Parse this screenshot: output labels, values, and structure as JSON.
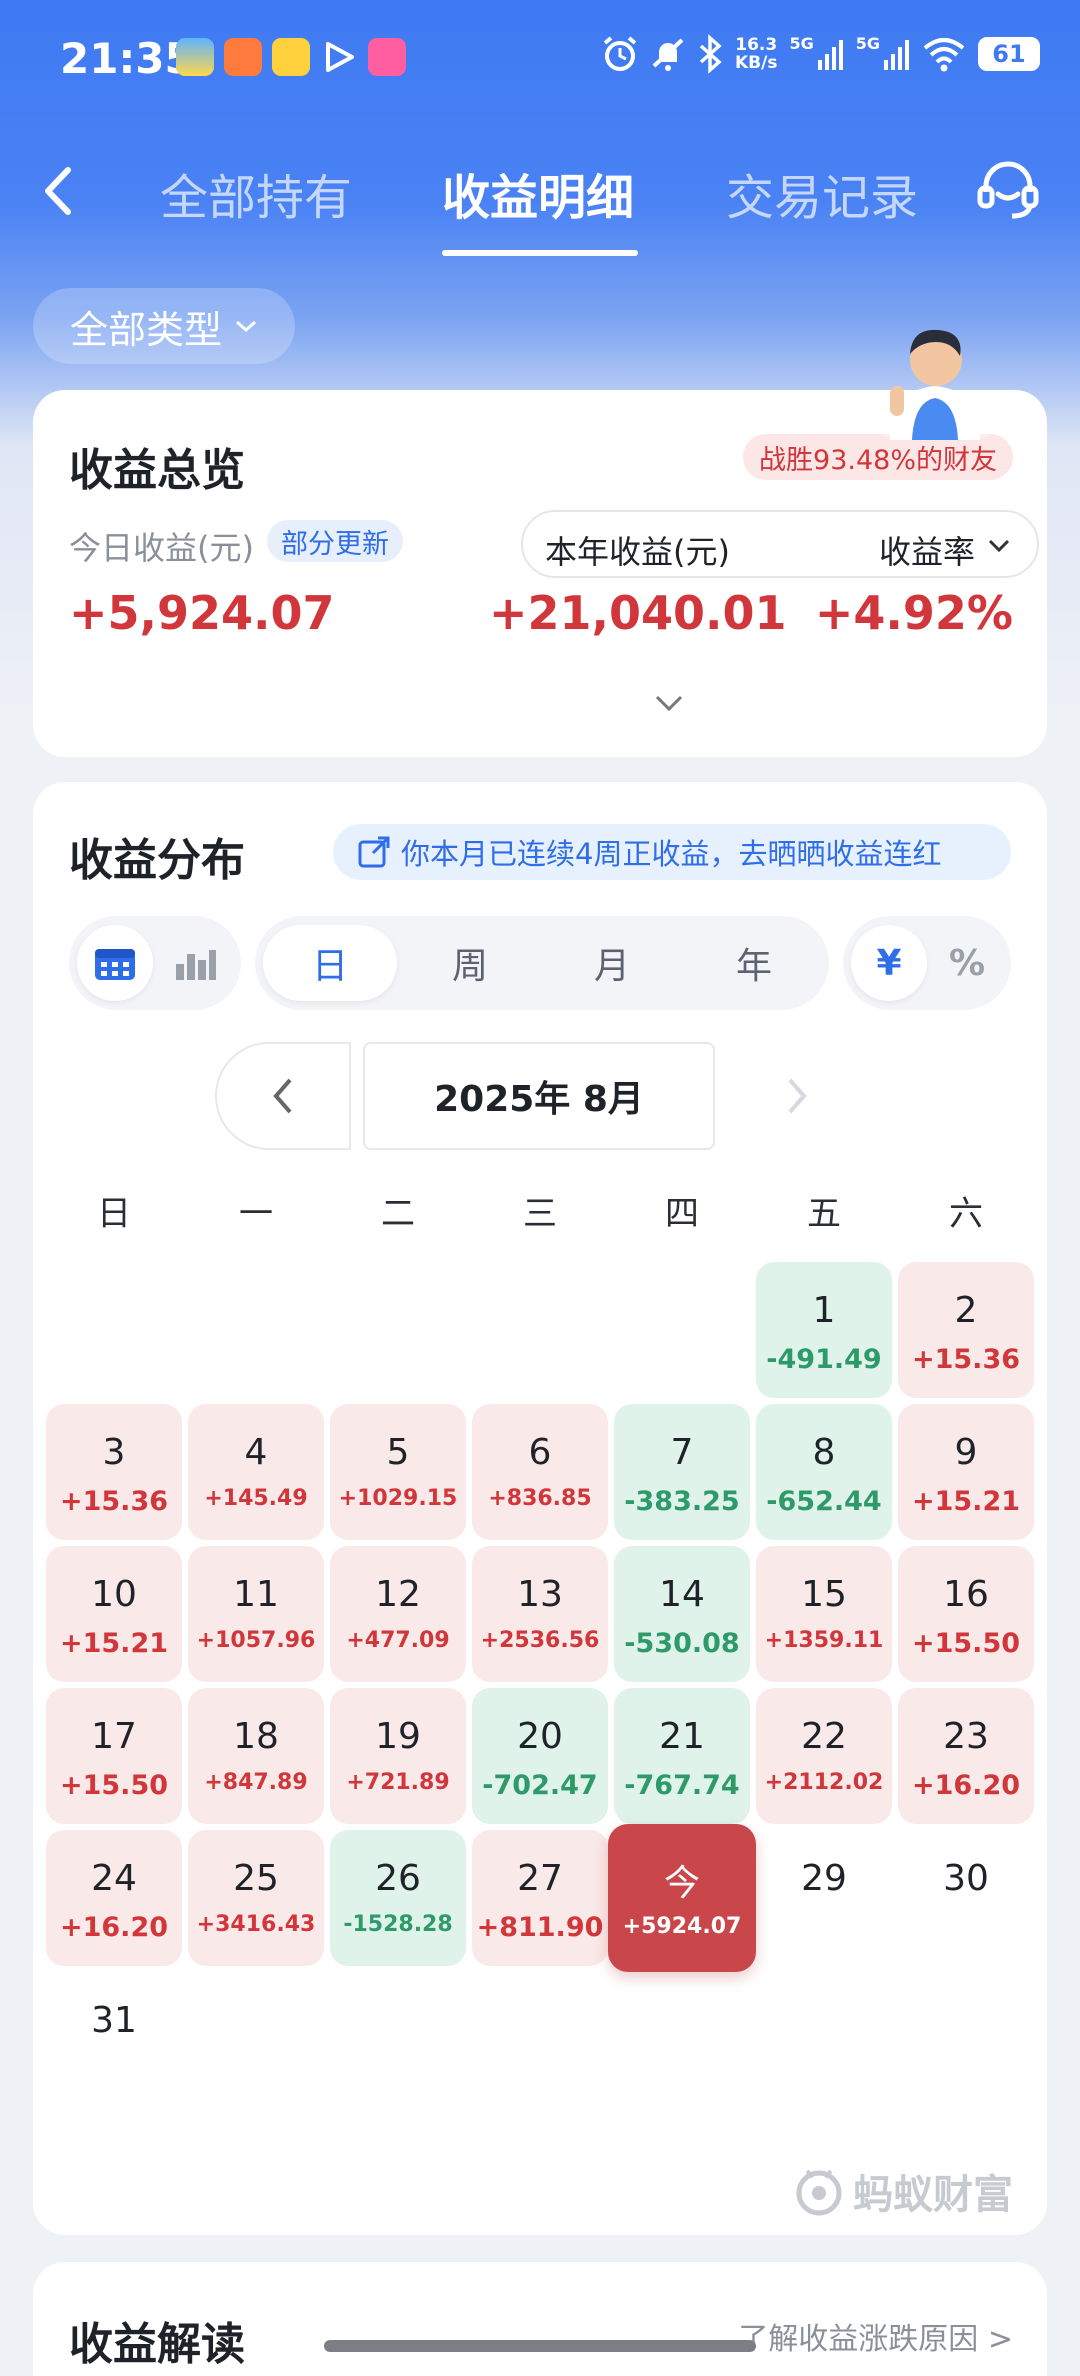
{
  "status": {
    "time": "21:35",
    "net_speed_value": "16.3",
    "net_speed_unit": "KB/s",
    "signal1": "5G",
    "signal2": "5G",
    "battery": "61"
  },
  "nav": {
    "tabs": [
      "全部持有",
      "收益明细",
      "交易记录"
    ],
    "active_tab": "收益明细"
  },
  "filter": {
    "label": "全部类型"
  },
  "overview": {
    "title": "收益总览",
    "beat_badge": "战胜93.48%的财友",
    "today_label": "今日收益(元)",
    "partial_badge": "部分更新",
    "year_label": "本年收益(元)",
    "rate_label": "收益率",
    "today_value": "+5,924.07",
    "year_value": "+21,040.01",
    "rate_value": "+4.92%"
  },
  "distribution": {
    "title": "收益分布",
    "streak_banner": "你本月已连续4周正收益，去晒晒收益连红",
    "periods": [
      "日",
      "周",
      "月",
      "年"
    ],
    "unit_yuan": "¥",
    "unit_pct": "%",
    "month": "2025年 8月",
    "weekdays": [
      "日",
      "一",
      "二",
      "三",
      "四",
      "五",
      "六"
    ],
    "days": [
      {
        "d": "1",
        "v": "-491.49"
      },
      {
        "d": "2",
        "v": "+15.36"
      },
      {
        "d": "3",
        "v": "+15.36"
      },
      {
        "d": "4",
        "v": "+145.49"
      },
      {
        "d": "5",
        "v": "+1029.15"
      },
      {
        "d": "6",
        "v": "+836.85"
      },
      {
        "d": "7",
        "v": "-383.25"
      },
      {
        "d": "8",
        "v": "-652.44"
      },
      {
        "d": "9",
        "v": "+15.21"
      },
      {
        "d": "10",
        "v": "+15.21"
      },
      {
        "d": "11",
        "v": "+1057.96"
      },
      {
        "d": "12",
        "v": "+477.09"
      },
      {
        "d": "13",
        "v": "+2536.56"
      },
      {
        "d": "14",
        "v": "-530.08"
      },
      {
        "d": "15",
        "v": "+1359.11"
      },
      {
        "d": "16",
        "v": "+15.50"
      },
      {
        "d": "17",
        "v": "+15.50"
      },
      {
        "d": "18",
        "v": "+847.89"
      },
      {
        "d": "19",
        "v": "+721.89"
      },
      {
        "d": "20",
        "v": "-702.47"
      },
      {
        "d": "21",
        "v": "-767.74"
      },
      {
        "d": "22",
        "v": "+2112.02"
      },
      {
        "d": "23",
        "v": "+16.20"
      },
      {
        "d": "24",
        "v": "+16.20"
      },
      {
        "d": "25",
        "v": "+3416.43"
      },
      {
        "d": "26",
        "v": "-1528.28"
      },
      {
        "d": "27",
        "v": "+811.90"
      },
      {
        "d": "今",
        "v": "+5924.07"
      },
      {
        "d": "29",
        "v": ""
      },
      {
        "d": "30",
        "v": ""
      },
      {
        "d": "31",
        "v": ""
      }
    ],
    "watermark": "蚂蚁财富"
  },
  "analysis": {
    "title": "收益解读",
    "link": "了解收益涨跌原因 >"
  }
}
